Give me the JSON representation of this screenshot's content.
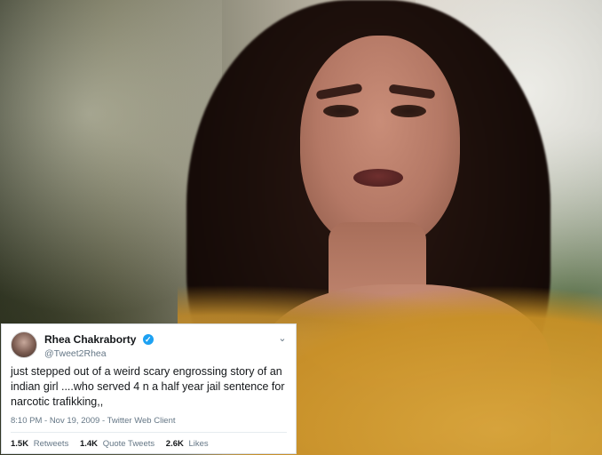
{
  "tweet": {
    "display_name": "Rhea Chakraborty",
    "handle": "@Tweet2Rhea",
    "text": "just stepped out of a weird scary engrossing story of an indian girl ....who served 4 n a half year jail sentence for narcotic trafikking,,",
    "meta": "8:10 PM - Nov 19, 2009 - Twitter Web Client",
    "stats": [
      {
        "count": "1.5K",
        "label": "Retweets"
      },
      {
        "count": "1.4K",
        "label": "Quote Tweets"
      },
      {
        "count": "2.6K",
        "label": "Likes"
      }
    ],
    "icons": {
      "verified": "verified-badge-icon",
      "menu": "chevron-down-icon"
    },
    "colors": {
      "verified_blue": "#1da1f2",
      "meta_gray": "#657786",
      "text_black": "#14171a",
      "border": "#d8dde2"
    }
  }
}
